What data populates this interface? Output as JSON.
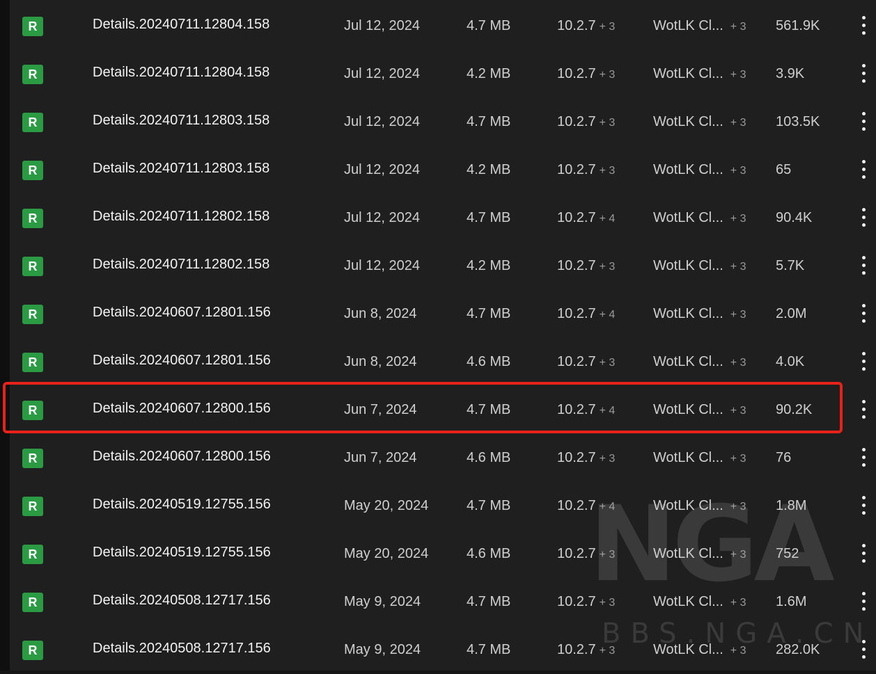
{
  "rows": [
    {
      "badge": "R",
      "name": "Details.20240711.12804.158",
      "date": "Jul 12, 2024",
      "size": "4.7 MB",
      "version": "10.2.7",
      "version_more": "+ 3",
      "flavor": "WotLK Cl...",
      "flavor_more": "+ 3",
      "downloads": "561.9K"
    },
    {
      "badge": "R",
      "name": "Details.20240711.12804.158",
      "date": "Jul 12, 2024",
      "size": "4.2 MB",
      "version": "10.2.7",
      "version_more": "+ 3",
      "flavor": "WotLK Cl...",
      "flavor_more": "+ 3",
      "downloads": "3.9K"
    },
    {
      "badge": "R",
      "name": "Details.20240711.12803.158",
      "date": "Jul 12, 2024",
      "size": "4.7 MB",
      "version": "10.2.7",
      "version_more": "+ 3",
      "flavor": "WotLK Cl...",
      "flavor_more": "+ 3",
      "downloads": "103.5K"
    },
    {
      "badge": "R",
      "name": "Details.20240711.12803.158",
      "date": "Jul 12, 2024",
      "size": "4.2 MB",
      "version": "10.2.7",
      "version_more": "+ 3",
      "flavor": "WotLK Cl...",
      "flavor_more": "+ 3",
      "downloads": "65"
    },
    {
      "badge": "R",
      "name": "Details.20240711.12802.158",
      "date": "Jul 12, 2024",
      "size": "4.7 MB",
      "version": "10.2.7",
      "version_more": "+ 4",
      "flavor": "WotLK Cl...",
      "flavor_more": "+ 3",
      "downloads": "90.4K"
    },
    {
      "badge": "R",
      "name": "Details.20240711.12802.158",
      "date": "Jul 12, 2024",
      "size": "4.2 MB",
      "version": "10.2.7",
      "version_more": "+ 3",
      "flavor": "WotLK Cl...",
      "flavor_more": "+ 3",
      "downloads": "5.7K"
    },
    {
      "badge": "R",
      "name": "Details.20240607.12801.156",
      "date": "Jun 8, 2024",
      "size": "4.7 MB",
      "version": "10.2.7",
      "version_more": "+ 4",
      "flavor": "WotLK Cl...",
      "flavor_more": "+ 3",
      "downloads": "2.0M"
    },
    {
      "badge": "R",
      "name": "Details.20240607.12801.156",
      "date": "Jun 8, 2024",
      "size": "4.6 MB",
      "version": "10.2.7",
      "version_more": "+ 3",
      "flavor": "WotLK Cl...",
      "flavor_more": "+ 3",
      "downloads": "4.0K"
    },
    {
      "badge": "R",
      "name": "Details.20240607.12800.156",
      "date": "Jun 7, 2024",
      "size": "4.7 MB",
      "version": "10.2.7",
      "version_more": "+ 4",
      "flavor": "WotLK Cl...",
      "flavor_more": "+ 3",
      "downloads": "90.2K",
      "highlighted": true
    },
    {
      "badge": "R",
      "name": "Details.20240607.12800.156",
      "date": "Jun 7, 2024",
      "size": "4.6 MB",
      "version": "10.2.7",
      "version_more": "+ 3",
      "flavor": "WotLK Cl...",
      "flavor_more": "+ 3",
      "downloads": "76"
    },
    {
      "badge": "R",
      "name": "Details.20240519.12755.156",
      "date": "May 20, 2024",
      "size": "4.7 MB",
      "version": "10.2.7",
      "version_more": "+ 4",
      "flavor": "WotLK Cl...",
      "flavor_more": "+ 3",
      "downloads": "1.8M"
    },
    {
      "badge": "R",
      "name": "Details.20240519.12755.156",
      "date": "May 20, 2024",
      "size": "4.6 MB",
      "version": "10.2.7",
      "version_more": "+ 3",
      "flavor": "WotLK Cl...",
      "flavor_more": "+ 3",
      "downloads": "752"
    },
    {
      "badge": "R",
      "name": "Details.20240508.12717.156",
      "date": "May 9, 2024",
      "size": "4.7 MB",
      "version": "10.2.7",
      "version_more": "+ 3",
      "flavor": "WotLK Cl...",
      "flavor_more": "+ 3",
      "downloads": "1.6M"
    },
    {
      "badge": "R",
      "name": "Details.20240508.12717.156",
      "date": "May 9, 2024",
      "size": "4.7 MB",
      "version": "10.2.7",
      "version_more": "+ 3",
      "flavor": "WotLK Cl...",
      "flavor_more": "+ 3",
      "downloads": "282.0K"
    }
  ],
  "colors": {
    "background": "#1f1f1f",
    "release_badge": "#2a9b43",
    "highlight_border": "#e8221b"
  },
  "icons": {
    "row_menu": "kebab-menu-icon",
    "release_type": "release-badge"
  },
  "watermark": {
    "logo_text": "NGA",
    "url_text": "BBS.NGA.CN"
  }
}
